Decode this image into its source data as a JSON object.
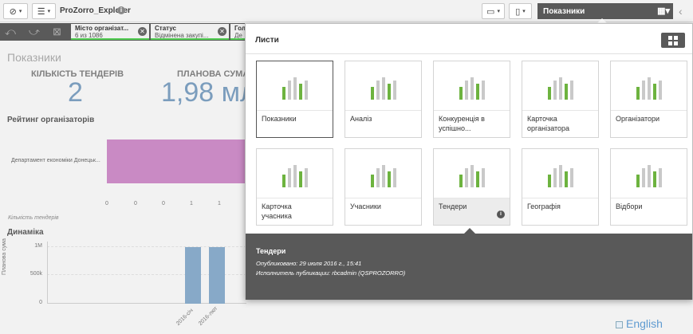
{
  "toolbar": {
    "app_name": "ProZorro_Explorer",
    "current_sheet": "Показники"
  },
  "selections": [
    {
      "title": "Місто організат...",
      "value": "6 из 1086"
    },
    {
      "title": "Статус",
      "value": "Відмінена закупі..."
    },
    {
      "title": "Гол",
      "value": "Де"
    }
  ],
  "sheet": {
    "title": "Показники",
    "kpis": [
      {
        "label": "КІЛЬКІСТЬ ТЕНДЕРІВ",
        "value": "2"
      },
      {
        "label": "ПЛАНОВА СУМА",
        "value": "1,98 мл"
      }
    ],
    "rating_title": "Рейтинг організаторів",
    "rating_category": "Департамент економіки Донецьк...",
    "rating_ticks": [
      "0",
      "0",
      "0",
      "1",
      "1"
    ],
    "rating_caption": "Кількість тендерів",
    "dynamics_title": "Динаміка",
    "dynamics_ylabel": "Планова сума",
    "dynamics_yticks": [
      "1M",
      "500k",
      "0"
    ],
    "dynamics_xticks": [
      "2016-січ",
      "2016-лют"
    ],
    "language_link": "English"
  },
  "chart_data": [
    {
      "type": "bar",
      "title": "Рейтинг організаторів",
      "categories": [
        "Департамент економіки Донецьк..."
      ],
      "xlabel": "Кількість тендерів",
      "values": [
        2
      ],
      "orientation": "horizontal"
    },
    {
      "type": "bar",
      "title": "Динаміка",
      "ylabel": "Планова сума",
      "categories": [
        "2016-січ",
        "2016-лют"
      ],
      "values": [
        990000,
        990000
      ],
      "ylim": [
        0,
        1000000
      ]
    }
  ],
  "popover": {
    "header": "Листи",
    "sheets": [
      {
        "name": "Показники"
      },
      {
        "name": "Аналіз"
      },
      {
        "name": "Конкуренція в успішно..."
      },
      {
        "name": "Карточка організатора"
      },
      {
        "name": "Організатори"
      },
      {
        "name": "Карточка учасника"
      },
      {
        "name": "Учасники"
      },
      {
        "name": "Тендери"
      },
      {
        "name": "Географія"
      },
      {
        "name": "Відбори"
      }
    ],
    "footer": {
      "title": "Тендери",
      "published": "Опубликовано: 29 июля 2016 г., 15:41",
      "publisher": "Исполнитель публикации: rbcadmin (QSPROZORRO)"
    },
    "colors": {
      "green": "#6db33f",
      "gray": "#c9c9c9",
      "dark": "#595959"
    }
  }
}
